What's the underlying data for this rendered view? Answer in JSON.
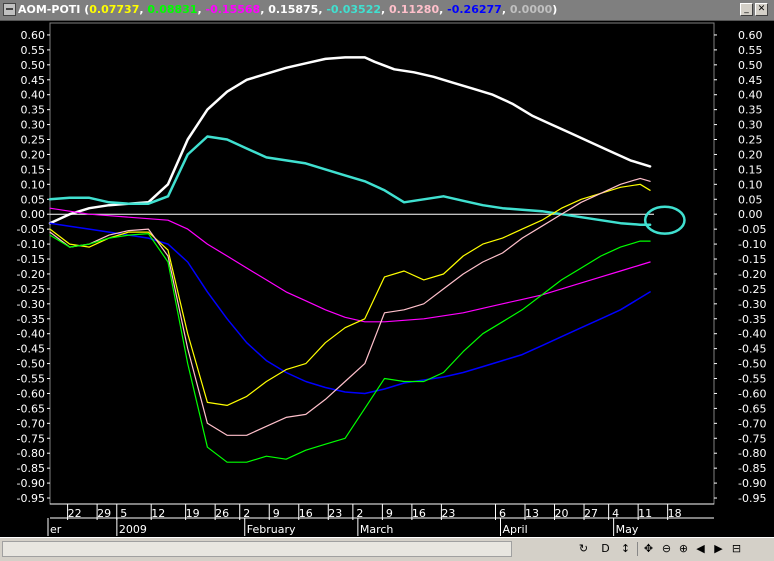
{
  "window": {
    "title": "AOM-POTI",
    "values": [
      {
        "text": "0.07737",
        "color": "#ffff00"
      },
      {
        "text": "0.08831",
        "color": "#00ff00"
      },
      {
        "text": "-0.15568",
        "color": "#ff00ff"
      },
      {
        "text": "0.15875",
        "color": "#ffffff"
      },
      {
        "text": "-0.03522",
        "color": "#40e0d0"
      },
      {
        "text": "0.11280",
        "color": "#ffc0cb"
      },
      {
        "text": "-0.26277",
        "color": "#0000ff"
      },
      {
        "text": "0.0000",
        "color": "#c0c0c0"
      }
    ],
    "minimize_glyph": "_",
    "close_glyph": "✕"
  },
  "toolbar": {
    "refresh_glyph": "↻",
    "data_glyph": "D",
    "updown_glyph": "↕",
    "move_glyph": "✥",
    "zoom_out_glyph": "⊖",
    "zoom_in_glyph": "⊕",
    "prev_glyph": "◀",
    "next_glyph": "▶",
    "menu_glyph": "⊟"
  },
  "chart_data": {
    "type": "line",
    "ylim": [
      -0.97,
      0.64
    ],
    "y_ticks": [
      "0.60",
      "0.55",
      "0.50",
      "0.45",
      "0.40",
      "0.35",
      "0.30",
      "0.25",
      "0.20",
      "0.15",
      "0.10",
      "0.05",
      "0.00",
      "-0.05",
      "-0.10",
      "-0.15",
      "-0.20",
      "-0.25",
      "-0.30",
      "-0.35",
      "-0.40",
      "-0.45",
      "-0.50",
      "-0.55",
      "-0.60",
      "-0.65",
      "-0.70",
      "-0.75",
      "-0.80",
      "-0.85",
      "-0.90",
      "-0.95"
    ],
    "x_day_labels": [
      "22",
      "29",
      "5",
      "12",
      "19",
      "26",
      "2",
      "9",
      "16",
      "23",
      "2",
      "9",
      "16",
      "23",
      "6",
      "13",
      "20",
      "27",
      "4",
      "11",
      "18"
    ],
    "x_month_labels": [
      "er",
      "2009",
      "February",
      "March",
      "April",
      "May"
    ],
    "x_range_index": [
      0,
      135
    ],
    "x_day_label_index": [
      5,
      11,
      15,
      22,
      29,
      35,
      40,
      46,
      52,
      58,
      63,
      69,
      75,
      81,
      92,
      98,
      104,
      110,
      115,
      121,
      127
    ],
    "x_month_label_index": [
      0,
      14,
      40,
      63,
      92,
      115
    ],
    "zero_line": true,
    "series": [
      {
        "color": "#ffffff",
        "width": 2.5,
        "x": [
          0,
          4,
          8,
          12,
          16,
          20,
          24,
          28,
          32,
          36,
          40,
          44,
          48,
          52,
          56,
          60,
          64,
          66,
          70,
          74,
          78,
          82,
          86,
          90,
          94,
          98,
          102,
          106,
          110,
          114,
          118,
          122
        ],
        "y": [
          -0.03,
          0.0,
          0.02,
          0.03,
          0.035,
          0.04,
          0.1,
          0.25,
          0.35,
          0.41,
          0.45,
          0.47,
          0.49,
          0.505,
          0.52,
          0.525,
          0.525,
          0.51,
          0.485,
          0.475,
          0.46,
          0.44,
          0.42,
          0.4,
          0.37,
          0.33,
          0.3,
          0.27,
          0.24,
          0.21,
          0.18,
          0.16
        ]
      },
      {
        "color": "#40e0d0",
        "width": 2.5,
        "x": [
          0,
          4,
          8,
          12,
          16,
          20,
          24,
          28,
          32,
          36,
          40,
          44,
          48,
          52,
          56,
          60,
          64,
          68,
          72,
          76,
          80,
          84,
          88,
          92,
          96,
          100,
          104,
          108,
          112,
          116,
          120,
          122
        ],
        "y": [
          0.05,
          0.055,
          0.055,
          0.04,
          0.035,
          0.035,
          0.06,
          0.2,
          0.26,
          0.25,
          0.22,
          0.19,
          0.18,
          0.17,
          0.15,
          0.13,
          0.11,
          0.08,
          0.04,
          0.05,
          0.06,
          0.045,
          0.03,
          0.02,
          0.015,
          0.01,
          0.0,
          -0.01,
          -0.02,
          -0.03,
          -0.035,
          -0.035
        ]
      },
      {
        "color": "#ff00ff",
        "width": 1.2,
        "x": [
          0,
          4,
          8,
          12,
          16,
          20,
          24,
          28,
          32,
          36,
          40,
          44,
          48,
          52,
          56,
          60,
          64,
          68,
          72,
          76,
          80,
          84,
          88,
          92,
          96,
          100,
          104,
          108,
          112,
          116,
          120,
          122
        ],
        "y": [
          0.02,
          0.01,
          0.0,
          -0.005,
          -0.01,
          -0.015,
          -0.02,
          -0.05,
          -0.1,
          -0.14,
          -0.18,
          -0.22,
          -0.26,
          -0.29,
          -0.32,
          -0.345,
          -0.36,
          -0.36,
          -0.355,
          -0.35,
          -0.34,
          -0.33,
          -0.315,
          -0.3,
          -0.285,
          -0.27,
          -0.25,
          -0.23,
          -0.21,
          -0.19,
          -0.17,
          -0.16
        ]
      },
      {
        "color": "#0000ff",
        "width": 1.5,
        "x": [
          0,
          4,
          8,
          12,
          16,
          20,
          24,
          28,
          32,
          36,
          40,
          44,
          48,
          52,
          56,
          60,
          64,
          68,
          72,
          76,
          80,
          84,
          88,
          92,
          96,
          100,
          104,
          108,
          112,
          116,
          120,
          122
        ],
        "y": [
          -0.03,
          -0.04,
          -0.05,
          -0.06,
          -0.07,
          -0.08,
          -0.1,
          -0.16,
          -0.26,
          -0.35,
          -0.43,
          -0.49,
          -0.53,
          -0.56,
          -0.58,
          -0.595,
          -0.6,
          -0.585,
          -0.565,
          -0.555,
          -0.545,
          -0.53,
          -0.51,
          -0.49,
          -0.47,
          -0.44,
          -0.41,
          -0.38,
          -0.35,
          -0.32,
          -0.28,
          -0.26
        ]
      },
      {
        "color": "#ffff00",
        "width": 1.2,
        "x": [
          0,
          4,
          8,
          12,
          16,
          20,
          24,
          28,
          32,
          36,
          40,
          44,
          48,
          52,
          56,
          60,
          64,
          68,
          72,
          76,
          80,
          84,
          88,
          92,
          96,
          100,
          104,
          108,
          112,
          116,
          120,
          122
        ],
        "y": [
          -0.05,
          -0.1,
          -0.11,
          -0.08,
          -0.06,
          -0.06,
          -0.12,
          -0.4,
          -0.63,
          -0.64,
          -0.61,
          -0.56,
          -0.52,
          -0.5,
          -0.43,
          -0.38,
          -0.35,
          -0.21,
          -0.19,
          -0.22,
          -0.2,
          -0.14,
          -0.1,
          -0.08,
          -0.05,
          -0.02,
          0.02,
          0.05,
          0.07,
          0.09,
          0.1,
          0.08
        ]
      },
      {
        "color": "#ffc0cb",
        "width": 1.2,
        "x": [
          0,
          4,
          8,
          12,
          16,
          20,
          24,
          28,
          32,
          36,
          40,
          44,
          48,
          52,
          56,
          60,
          64,
          68,
          72,
          76,
          80,
          84,
          88,
          92,
          96,
          100,
          104,
          108,
          112,
          116,
          120,
          122
        ],
        "y": [
          -0.06,
          -0.11,
          -0.1,
          -0.07,
          -0.055,
          -0.05,
          -0.14,
          -0.45,
          -0.7,
          -0.74,
          -0.74,
          -0.71,
          -0.68,
          -0.67,
          -0.62,
          -0.56,
          -0.5,
          -0.33,
          -0.32,
          -0.3,
          -0.25,
          -0.2,
          -0.16,
          -0.13,
          -0.08,
          -0.04,
          0.0,
          0.04,
          0.07,
          0.1,
          0.12,
          0.11
        ]
      },
      {
        "color": "#00ff00",
        "width": 1.2,
        "x": [
          0,
          4,
          8,
          12,
          16,
          20,
          24,
          28,
          32,
          36,
          40,
          44,
          48,
          52,
          56,
          60,
          64,
          68,
          72,
          76,
          80,
          84,
          88,
          92,
          96,
          100,
          104,
          108,
          112,
          116,
          120,
          122
        ],
        "y": [
          -0.07,
          -0.11,
          -0.1,
          -0.08,
          -0.07,
          -0.065,
          -0.16,
          -0.5,
          -0.78,
          -0.83,
          -0.83,
          -0.81,
          -0.82,
          -0.79,
          -0.77,
          -0.75,
          -0.65,
          -0.55,
          -0.56,
          -0.56,
          -0.53,
          -0.46,
          -0.4,
          -0.36,
          -0.32,
          -0.27,
          -0.22,
          -0.18,
          -0.14,
          -0.11,
          -0.09,
          -0.09
        ]
      }
    ],
    "annotation": {
      "type": "ellipse",
      "color": "#40e0d0",
      "center_x": 125,
      "center_y": -0.02,
      "radius_x_units": 4,
      "radius_y_units": 0.045
    }
  }
}
